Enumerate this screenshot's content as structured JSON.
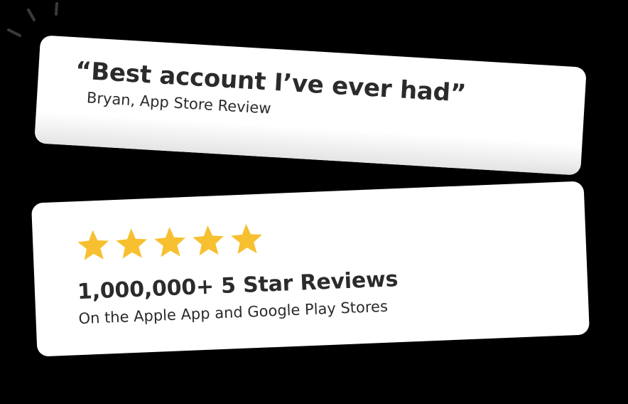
{
  "quote_card": {
    "quote": "“Best account I’ve ever had”",
    "author": "Bryan, App Store Review"
  },
  "reviews_card": {
    "rating": 5,
    "star_icon": "star-icon",
    "star_color": "#f7c030",
    "title": "1,000,000+ 5 Star Reviews",
    "subtitle": "On the Apple App and Google Play Stores"
  },
  "colors": {
    "background": "#000000",
    "card": "#ffffff",
    "text": "#2b2b2b",
    "spark": "#3a3a3a"
  }
}
